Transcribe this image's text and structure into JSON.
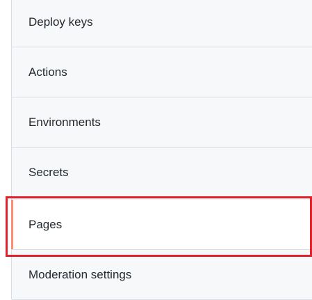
{
  "settings_nav": {
    "items": [
      {
        "label": "Deploy keys",
        "selected": false
      },
      {
        "label": "Actions",
        "selected": false
      },
      {
        "label": "Environments",
        "selected": false
      },
      {
        "label": "Secrets",
        "selected": false
      },
      {
        "label": "Pages",
        "selected": true
      },
      {
        "label": "Moderation settings",
        "selected": false
      }
    ]
  },
  "colors": {
    "selected_indicator": "#fd8c73",
    "highlight_box": "#e0202a",
    "item_background": "#f6f8fa",
    "selected_background": "#ffffff"
  }
}
